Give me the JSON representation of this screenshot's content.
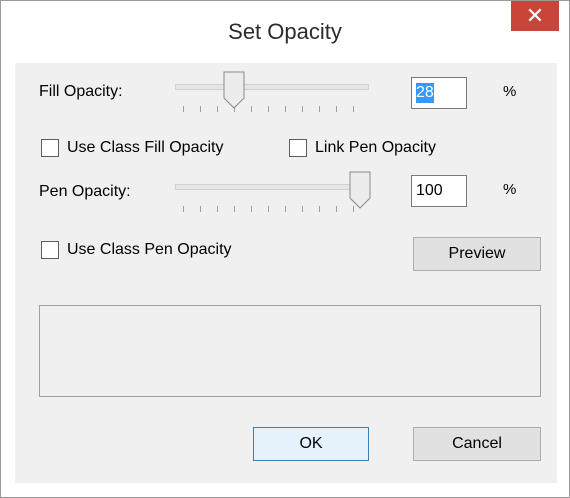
{
  "window": {
    "title": "Set Opacity",
    "close_symbol": "✕"
  },
  "fill": {
    "label": "Fill Opacity:",
    "value": "28",
    "percent_symbol": "%",
    "slider_fraction": 0.28,
    "use_class_label": "Use Class Fill Opacity",
    "use_class_checked": false
  },
  "link": {
    "label": "Link Pen Opacity",
    "checked": false
  },
  "pen": {
    "label": "Pen Opacity:",
    "value": "100",
    "percent_symbol": "%",
    "slider_fraction": 1.0,
    "use_class_label": "Use Class Pen Opacity",
    "use_class_checked": false
  },
  "buttons": {
    "preview": "Preview",
    "ok": "OK",
    "cancel": "Cancel"
  },
  "colors": {
    "close_bg": "#c9453a",
    "selection": "#3399ff",
    "dialog_bg": "#f0f0f0"
  }
}
